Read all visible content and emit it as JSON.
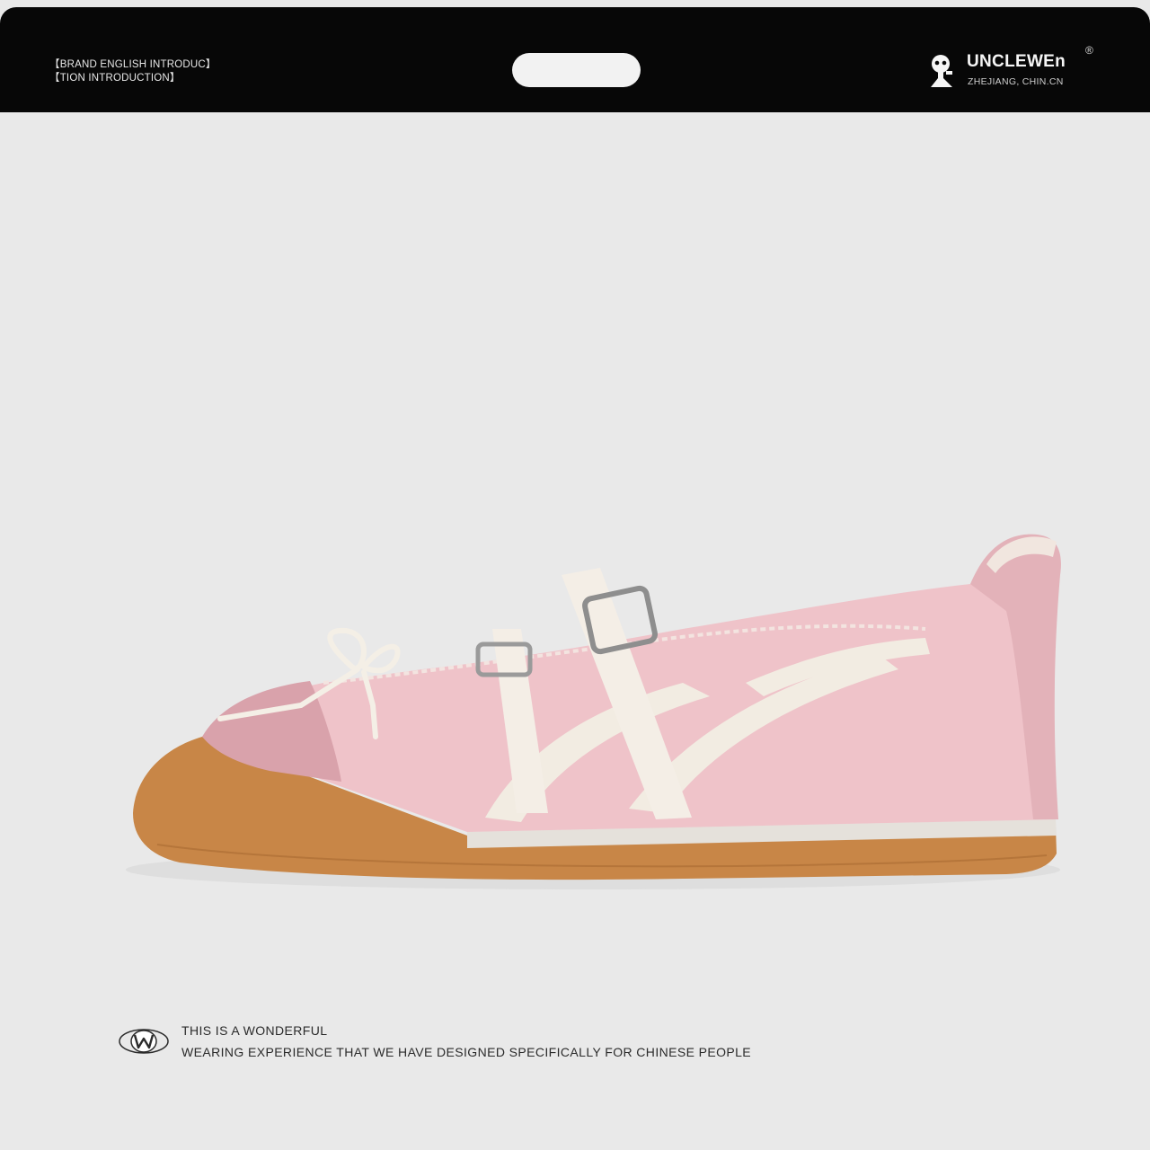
{
  "header": {
    "intro_line_1": "【BRAND ENGLISH INTRODUC】",
    "intro_line_2": "【TION INTRODUCTION】",
    "brand": {
      "name": "UNCLEWEn",
      "registered": "®",
      "location": "ZHEJIANG, CHIN.CN",
      "logo_icon": "mascot-logo-icon"
    }
  },
  "product": {
    "image": "pink ballet-style sneaker with double buckle straps and bow",
    "colors": {
      "upper": "#efc3c9",
      "suede": "#d9a2ab",
      "stripe": "#f2ece2",
      "sole": "#c98a4a",
      "midsole": "#e6e2dc"
    }
  },
  "footer": {
    "mark_icon": "w-circle-logo-icon",
    "tagline_line_1": "THIS IS A WONDERFUL",
    "tagline_line_2": "WEARING EXPERIENCE THAT WE HAVE DESIGNED SPECIFICALLY FOR CHINESE PEOPLE"
  }
}
